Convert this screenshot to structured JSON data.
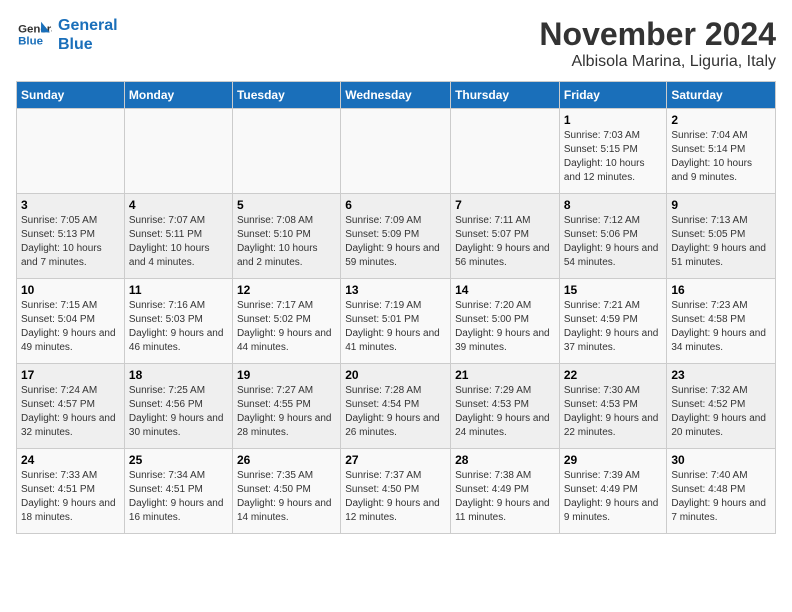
{
  "logo": {
    "line1": "General",
    "line2": "Blue"
  },
  "title": "November 2024",
  "location": "Albisola Marina, Liguria, Italy",
  "weekdays": [
    "Sunday",
    "Monday",
    "Tuesday",
    "Wednesday",
    "Thursday",
    "Friday",
    "Saturday"
  ],
  "weeks": [
    [
      {
        "day": "",
        "info": ""
      },
      {
        "day": "",
        "info": ""
      },
      {
        "day": "",
        "info": ""
      },
      {
        "day": "",
        "info": ""
      },
      {
        "day": "",
        "info": ""
      },
      {
        "day": "1",
        "info": "Sunrise: 7:03 AM\nSunset: 5:15 PM\nDaylight: 10 hours and 12 minutes."
      },
      {
        "day": "2",
        "info": "Sunrise: 7:04 AM\nSunset: 5:14 PM\nDaylight: 10 hours and 9 minutes."
      }
    ],
    [
      {
        "day": "3",
        "info": "Sunrise: 7:05 AM\nSunset: 5:13 PM\nDaylight: 10 hours and 7 minutes."
      },
      {
        "day": "4",
        "info": "Sunrise: 7:07 AM\nSunset: 5:11 PM\nDaylight: 10 hours and 4 minutes."
      },
      {
        "day": "5",
        "info": "Sunrise: 7:08 AM\nSunset: 5:10 PM\nDaylight: 10 hours and 2 minutes."
      },
      {
        "day": "6",
        "info": "Sunrise: 7:09 AM\nSunset: 5:09 PM\nDaylight: 9 hours and 59 minutes."
      },
      {
        "day": "7",
        "info": "Sunrise: 7:11 AM\nSunset: 5:07 PM\nDaylight: 9 hours and 56 minutes."
      },
      {
        "day": "8",
        "info": "Sunrise: 7:12 AM\nSunset: 5:06 PM\nDaylight: 9 hours and 54 minutes."
      },
      {
        "day": "9",
        "info": "Sunrise: 7:13 AM\nSunset: 5:05 PM\nDaylight: 9 hours and 51 minutes."
      }
    ],
    [
      {
        "day": "10",
        "info": "Sunrise: 7:15 AM\nSunset: 5:04 PM\nDaylight: 9 hours and 49 minutes."
      },
      {
        "day": "11",
        "info": "Sunrise: 7:16 AM\nSunset: 5:03 PM\nDaylight: 9 hours and 46 minutes."
      },
      {
        "day": "12",
        "info": "Sunrise: 7:17 AM\nSunset: 5:02 PM\nDaylight: 9 hours and 44 minutes."
      },
      {
        "day": "13",
        "info": "Sunrise: 7:19 AM\nSunset: 5:01 PM\nDaylight: 9 hours and 41 minutes."
      },
      {
        "day": "14",
        "info": "Sunrise: 7:20 AM\nSunset: 5:00 PM\nDaylight: 9 hours and 39 minutes."
      },
      {
        "day": "15",
        "info": "Sunrise: 7:21 AM\nSunset: 4:59 PM\nDaylight: 9 hours and 37 minutes."
      },
      {
        "day": "16",
        "info": "Sunrise: 7:23 AM\nSunset: 4:58 PM\nDaylight: 9 hours and 34 minutes."
      }
    ],
    [
      {
        "day": "17",
        "info": "Sunrise: 7:24 AM\nSunset: 4:57 PM\nDaylight: 9 hours and 32 minutes."
      },
      {
        "day": "18",
        "info": "Sunrise: 7:25 AM\nSunset: 4:56 PM\nDaylight: 9 hours and 30 minutes."
      },
      {
        "day": "19",
        "info": "Sunrise: 7:27 AM\nSunset: 4:55 PM\nDaylight: 9 hours and 28 minutes."
      },
      {
        "day": "20",
        "info": "Sunrise: 7:28 AM\nSunset: 4:54 PM\nDaylight: 9 hours and 26 minutes."
      },
      {
        "day": "21",
        "info": "Sunrise: 7:29 AM\nSunset: 4:53 PM\nDaylight: 9 hours and 24 minutes."
      },
      {
        "day": "22",
        "info": "Sunrise: 7:30 AM\nSunset: 4:53 PM\nDaylight: 9 hours and 22 minutes."
      },
      {
        "day": "23",
        "info": "Sunrise: 7:32 AM\nSunset: 4:52 PM\nDaylight: 9 hours and 20 minutes."
      }
    ],
    [
      {
        "day": "24",
        "info": "Sunrise: 7:33 AM\nSunset: 4:51 PM\nDaylight: 9 hours and 18 minutes."
      },
      {
        "day": "25",
        "info": "Sunrise: 7:34 AM\nSunset: 4:51 PM\nDaylight: 9 hours and 16 minutes."
      },
      {
        "day": "26",
        "info": "Sunrise: 7:35 AM\nSunset: 4:50 PM\nDaylight: 9 hours and 14 minutes."
      },
      {
        "day": "27",
        "info": "Sunrise: 7:37 AM\nSunset: 4:50 PM\nDaylight: 9 hours and 12 minutes."
      },
      {
        "day": "28",
        "info": "Sunrise: 7:38 AM\nSunset: 4:49 PM\nDaylight: 9 hours and 11 minutes."
      },
      {
        "day": "29",
        "info": "Sunrise: 7:39 AM\nSunset: 4:49 PM\nDaylight: 9 hours and 9 minutes."
      },
      {
        "day": "30",
        "info": "Sunrise: 7:40 AM\nSunset: 4:48 PM\nDaylight: 9 hours and 7 minutes."
      }
    ]
  ]
}
